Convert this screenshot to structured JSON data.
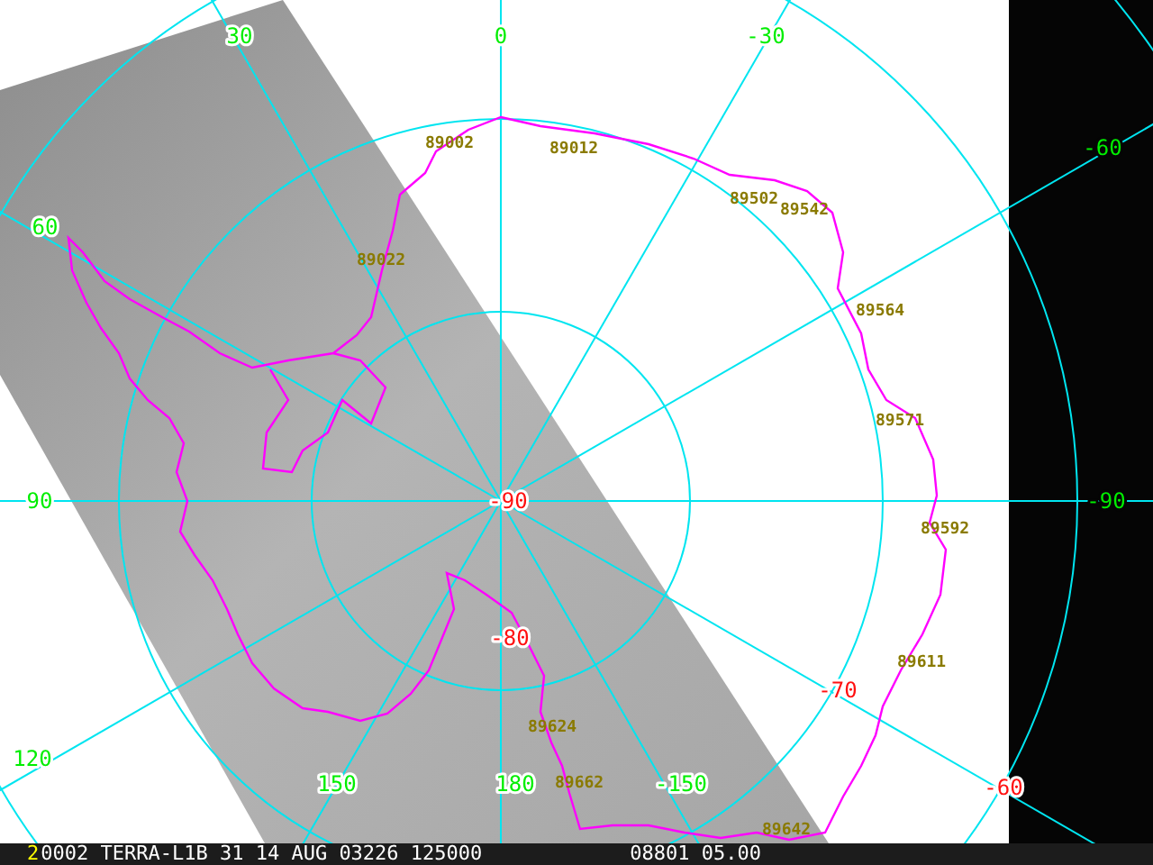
{
  "map": {
    "longitude_labels": [
      "30",
      "0",
      "-30",
      "-60",
      "60",
      "90",
      "-90",
      "120",
      "150",
      "180",
      "-150"
    ],
    "latitude_labels": [
      "-90",
      "-80",
      "-70",
      "-60"
    ],
    "station_labels": [
      "89002",
      "89012",
      "89022",
      "89502",
      "89542",
      "89564",
      "89571",
      "89592",
      "89611",
      "89624",
      "89662",
      "89642"
    ]
  },
  "status_bar": {
    "channel": "2",
    "text": "0002 TERRA-L1B 31 14 AUG 03226 125000",
    "time": "08801 05.00"
  }
}
